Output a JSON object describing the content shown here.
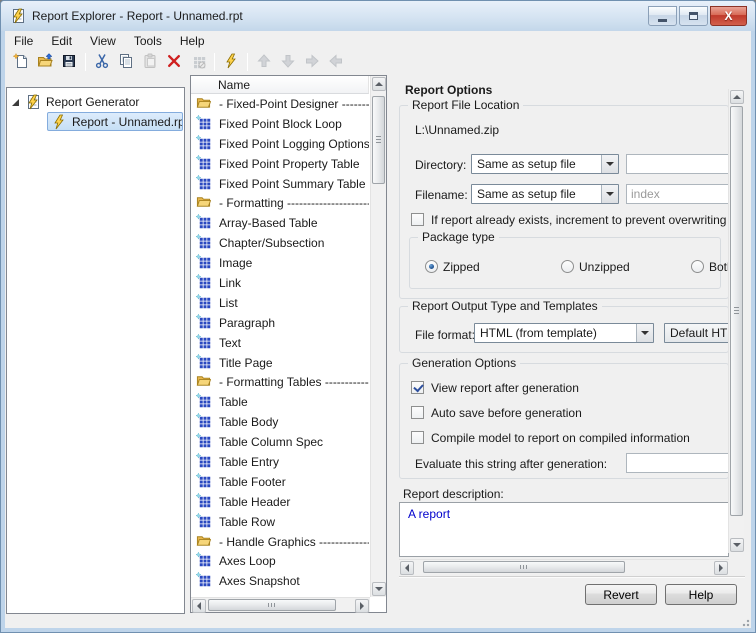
{
  "window": {
    "title": "Report Explorer - Report - Unnamed.rpt"
  },
  "menu": {
    "items": [
      "File",
      "Edit",
      "View",
      "Tools",
      "Help"
    ]
  },
  "toolbar": {
    "buttons": [
      {
        "name": "new-report-button",
        "icon": "new-document-icon",
        "enabled": true
      },
      {
        "name": "open-report-button",
        "icon": "open-folder-icon",
        "enabled": true
      },
      {
        "name": "save-report-button",
        "icon": "save-icon",
        "enabled": true
      },
      {
        "sep": true
      },
      {
        "name": "cut-button",
        "icon": "cut-icon",
        "enabled": true
      },
      {
        "name": "copy-button",
        "icon": "copy-icon",
        "enabled": true
      },
      {
        "name": "paste-button",
        "icon": "paste-icon",
        "enabled": false
      },
      {
        "name": "delete-button",
        "icon": "delete-icon",
        "enabled": true
      },
      {
        "name": "add-component-button",
        "icon": "component-disabled-icon",
        "enabled": false
      },
      {
        "sep": true
      },
      {
        "name": "generate-report-button",
        "icon": "lightning-icon",
        "enabled": true
      },
      {
        "sep": true
      },
      {
        "name": "move-up-button",
        "icon": "arrow-up-icon",
        "enabled": false
      },
      {
        "name": "move-down-button",
        "icon": "arrow-down-icon",
        "enabled": false
      },
      {
        "name": "move-right-button",
        "icon": "arrow-right-icon",
        "enabled": false
      },
      {
        "name": "move-left-button",
        "icon": "arrow-left-icon",
        "enabled": false
      }
    ]
  },
  "outline_tree": {
    "root_label": "Report Generator",
    "selected_item": "Report - Unnamed.rpt*"
  },
  "component_list": {
    "header": "Name",
    "items": [
      {
        "type": "folder",
        "label": "- Fixed-Point Designer ------------"
      },
      {
        "type": "component",
        "label": "Fixed Point Block Loop"
      },
      {
        "type": "component",
        "label": "Fixed Point Logging Options"
      },
      {
        "type": "component",
        "label": "Fixed Point Property Table"
      },
      {
        "type": "component",
        "label": "Fixed Point Summary Table"
      },
      {
        "type": "folder",
        "label": "- Formatting ------------------------"
      },
      {
        "type": "component",
        "label": "Array-Based Table"
      },
      {
        "type": "component",
        "label": "Chapter/Subsection"
      },
      {
        "type": "component",
        "label": "Image"
      },
      {
        "type": "component",
        "label": "Link"
      },
      {
        "type": "component",
        "label": "List"
      },
      {
        "type": "component",
        "label": "Paragraph"
      },
      {
        "type": "component",
        "label": "Text"
      },
      {
        "type": "component",
        "label": "Title Page"
      },
      {
        "type": "folder",
        "label": "- Formatting Tables ---------------"
      },
      {
        "type": "component",
        "label": "Table"
      },
      {
        "type": "component",
        "label": "Table Body"
      },
      {
        "type": "component",
        "label": "Table Column Spec"
      },
      {
        "type": "component",
        "label": "Table Entry"
      },
      {
        "type": "component",
        "label": "Table Footer"
      },
      {
        "type": "component",
        "label": "Table Header"
      },
      {
        "type": "component",
        "label": "Table Row"
      },
      {
        "type": "folder",
        "label": "- Handle Graphics ----------------"
      },
      {
        "type": "component",
        "label": "Axes Loop"
      },
      {
        "type": "component",
        "label": "Axes Snapshot"
      }
    ]
  },
  "options": {
    "title": "Report Options",
    "file_location": {
      "group_label": "Report File Location",
      "path": "L:\\Unnamed.zip",
      "directory_label": "Directory:",
      "directory_value": "Same as setup file",
      "directory_field_value": "",
      "filename_label": "Filename:",
      "filename_value": "Same as setup file",
      "filename_field_value": "index",
      "increment_label": "If report already exists, increment to prevent overwriting",
      "increment_checked": false,
      "package": {
        "group_label": "Package type",
        "choices": [
          "Zipped",
          "Unzipped",
          "Both"
        ],
        "selected": "Zipped"
      }
    },
    "output": {
      "group_label": "Report Output Type and Templates",
      "file_format_label": "File format:",
      "file_format_value": "HTML (from template)",
      "template_button_label": "Default HTM"
    },
    "generation": {
      "group_label": "Generation Options",
      "checkboxes": [
        {
          "label": "View report after generation",
          "checked": true
        },
        {
          "label": "Auto save before generation",
          "checked": false
        },
        {
          "label": "Compile model to report on compiled information",
          "checked": false
        }
      ],
      "evaluate_label": "Evaluate this string after generation:",
      "evaluate_value": ""
    },
    "description": {
      "label": "Report description:",
      "value": "A report"
    }
  },
  "footer": {
    "revert_label": "Revert",
    "help_label": "Help"
  },
  "colors": {
    "accent_bolt": "#ffd34d",
    "selection_border": "#84acdd",
    "description_text": "#0000cc",
    "close_button": "#c0392b",
    "component_icon_blue": "#2a49c0",
    "folder_icon_yellow": "#f3c85f"
  }
}
